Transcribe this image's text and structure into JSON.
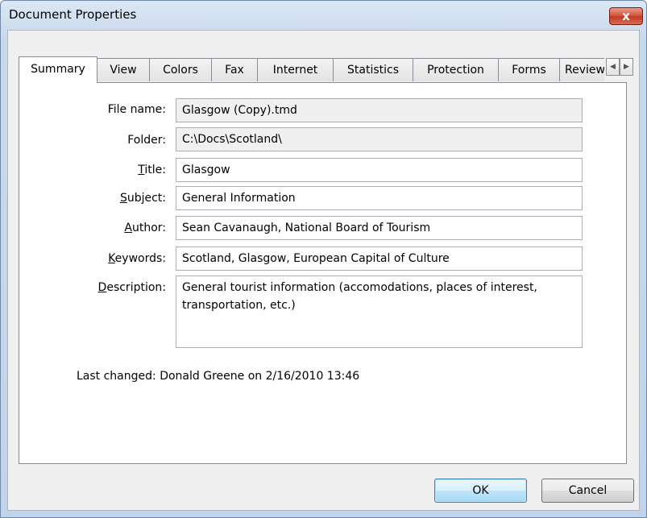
{
  "window": {
    "title": "Document Properties",
    "close_label": "x"
  },
  "tabs": [
    {
      "label": "Summary"
    },
    {
      "label": "View"
    },
    {
      "label": "Colors"
    },
    {
      "label": "Fax"
    },
    {
      "label": "Internet"
    },
    {
      "label": "Statistics"
    },
    {
      "label": "Protection"
    },
    {
      "label": "Forms"
    },
    {
      "label": "Review"
    }
  ],
  "tab_scroll": {
    "left": "◀",
    "right": "▶"
  },
  "fields": {
    "file_name": {
      "label": "File name:",
      "value": "Glasgow (Copy).tmd"
    },
    "folder": {
      "label": "Folder:",
      "value": "C:\\Docs\\Scotland\\"
    },
    "title": {
      "label_mnemonic": "T",
      "label_rest": "itle:",
      "value": "Glasgow"
    },
    "subject": {
      "label_mnemonic": "S",
      "label_rest": "ubject:",
      "value": "General Information"
    },
    "author": {
      "label_mnemonic": "A",
      "label_rest": "uthor:",
      "value": "Sean Cavanaugh, National Board of Tourism"
    },
    "keywords": {
      "label_mnemonic": "K",
      "label_rest": "eywords:",
      "value": "Scotland, Glasgow, European Capital of Culture"
    },
    "description": {
      "label_mnemonic": "D",
      "label_rest": "escription:",
      "value": "General tourist information (accomodations, places of interest, transportation, etc.)"
    }
  },
  "last_changed": {
    "label": "Last changed:",
    "value": "Donald Greene on 2/16/2010 13:46"
  },
  "buttons": {
    "ok": "OK",
    "cancel": "Cancel"
  }
}
